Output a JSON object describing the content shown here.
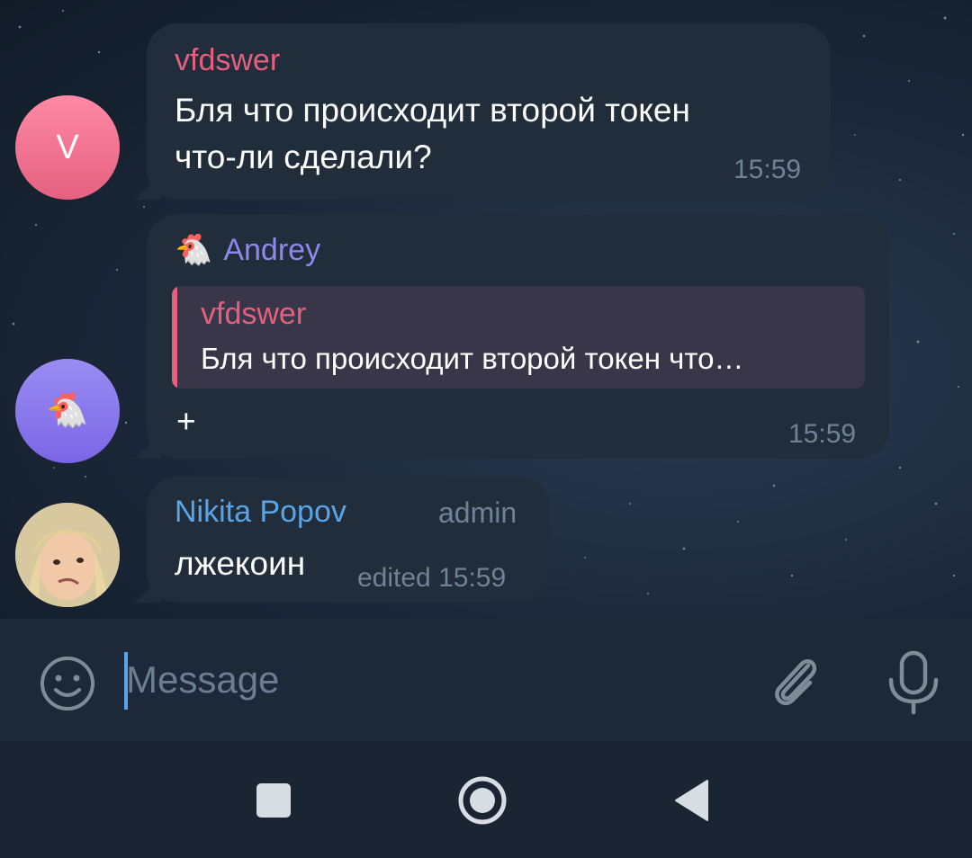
{
  "messages": [
    {
      "sender": "vfdswer",
      "avatar_letter": "V",
      "text_line1": "Бля что происходит второй токен",
      "text_line2": "что-ли сделали?",
      "time": "15:59"
    },
    {
      "sender": "Andrey",
      "sender_emoji": "🐔",
      "avatar_emoji": "🐔",
      "reply_name": "vfdswer",
      "reply_text": "Бля что происходит второй токен что…",
      "text": "+",
      "time": "15:59"
    },
    {
      "sender": "Nikita Popov",
      "role": "admin",
      "text": "лжекоин",
      "time": "edited 15:59"
    }
  ],
  "composer": {
    "placeholder": "Message",
    "emoji_icon": "smile-icon",
    "attach_icon": "paperclip-icon",
    "mic_icon": "microphone-icon"
  },
  "colors": {
    "name_vfdswer": "#e4607f",
    "name_andrey": "#8d87ee",
    "name_nikita": "#5aa5e8",
    "bubble": "#212d3b"
  }
}
